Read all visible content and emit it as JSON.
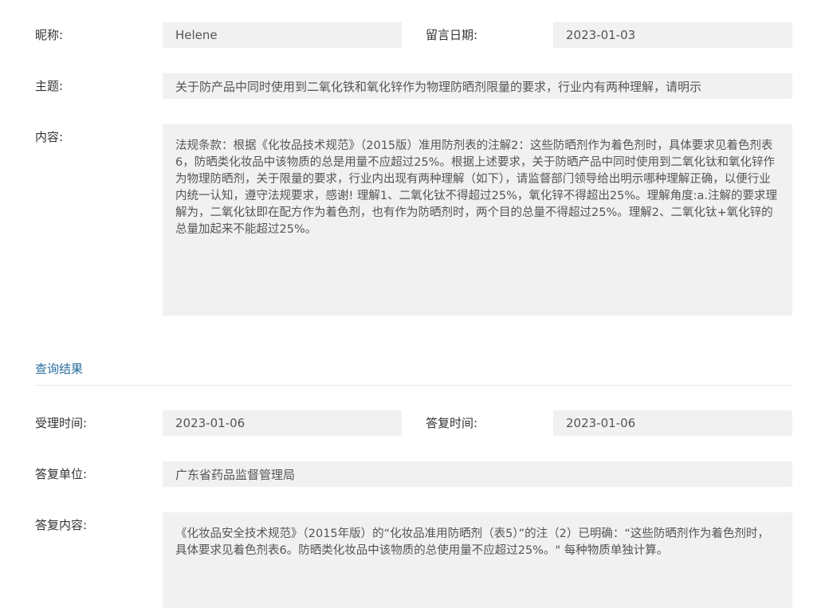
{
  "message": {
    "nickname_label": "昵称:",
    "nickname": "Helene",
    "date_label": "留言日期:",
    "date": "2023-01-03",
    "subject_label": "主题:",
    "subject": "关于防产品中同时使用到二氧化铁和氧化锌作为物理防晒剂限量的要求，行业内有两种理解，请明示",
    "content_label": "内容:",
    "content": "法规条款：根据《化妆品技术规范》（2015版）准用防剂表的注解2：这些防晒剂作为着色剂时，具体要求见着色剂表6，防晒类化妆品中该物质的总是用量不应超过25%。根据上述要求，关于防晒产品中同时使用到二氧化钛和氧化锌作为物理防晒剂，关于限量的要求，行业内出现有两种理解（如下），请监督部门领导给出明示哪种理解正确，以便行业内统一认知，遵守法规要求，感谢! 理解1、二氧化钛不得超过25%，氧化锌不得超出25%。理解角度:a.注解的要求理解为，二氧化钛即在配方作为着色剂，也有作为防晒剂时，两个目的总量不得超过25%。理解2、二氧化钛+氧化锌的总量加起来不能超过25%。"
  },
  "result": {
    "section_title": "查询结果",
    "accept_time_label": "受理时间:",
    "accept_time": "2023-01-06",
    "reply_time_label": "答复时间:",
    "reply_time": "2023-01-06",
    "reply_unit_label": "答复单位:",
    "reply_unit": "广东省药品监督管理局",
    "reply_content_label": "答复内容:",
    "reply_content": "《化妆品安全技术规范》（2015年版）的“化妆品准用防晒剂（表5）”的注（2）已明确：“这些防晒剂作为着色剂时，具体要求见着色剂表6。防晒类化妆品中该物质的总使用量不应超过25%。\" 每种物质单独计算。"
  }
}
